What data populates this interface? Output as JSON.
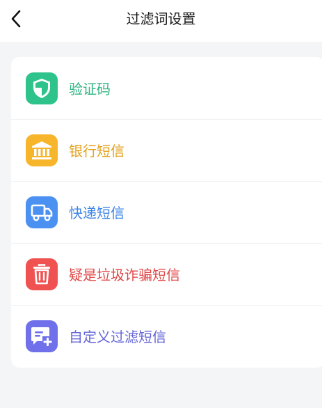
{
  "header": {
    "title": "过滤词设置"
  },
  "items": [
    {
      "label": "验证码",
      "icon": "shield-icon",
      "color": "#2fb483",
      "bg": "#2fc38c"
    },
    {
      "label": "银行短信",
      "icon": "bank-icon",
      "color": "#e4a11a",
      "bg": "#f7b52c"
    },
    {
      "label": "快递短信",
      "icon": "truck-icon",
      "color": "#3f86e6",
      "bg": "#4b91f1"
    },
    {
      "label": "疑是垃圾诈骗短信",
      "icon": "trash-icon",
      "color": "#e04848",
      "bg": "#f05252"
    },
    {
      "label": "自定义过滤短信",
      "icon": "message-add-icon",
      "color": "#6566d8",
      "bg": "#6f70ea"
    }
  ]
}
